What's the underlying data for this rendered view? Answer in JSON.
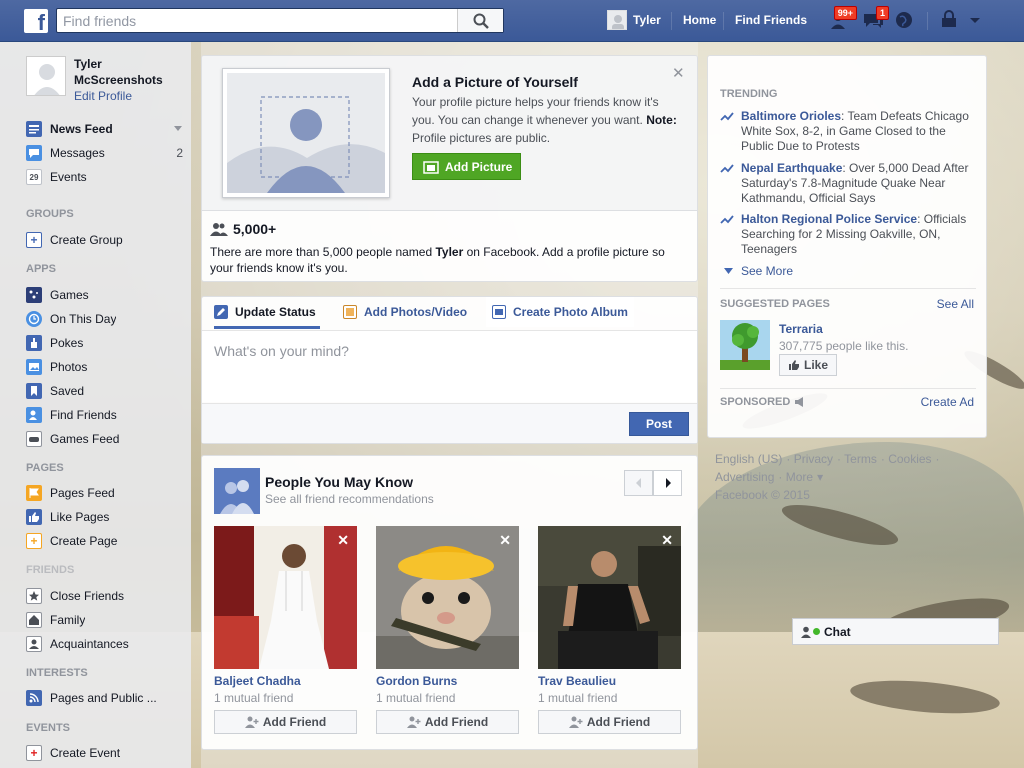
{
  "topbar": {
    "logo": "f",
    "search_placeholder": "Find friends",
    "user_name": "Tyler",
    "home": "Home",
    "find_friends": "Find Friends",
    "friend_requests_badge": "99+",
    "messages_badge": "1",
    "icons": [
      "search-icon",
      "friend-requests-icon",
      "messages-icon",
      "globe-icon",
      "privacy-icon",
      "chevron-down-icon"
    ]
  },
  "left": {
    "profile_name": "Tyler McScreenshots",
    "edit_profile": "Edit Profile",
    "items": {
      "news_feed": "News Feed",
      "messages": "Messages",
      "messages_count": "2",
      "events": "Events",
      "events_date": "29"
    },
    "groups_header": "GROUPS",
    "create_group": "Create Group",
    "apps_header": "APPS",
    "apps": [
      "Games",
      "On This Day",
      "Pokes",
      "Photos",
      "Saved",
      "Find Friends",
      "Games Feed"
    ],
    "pages_header": "PAGES",
    "pages": [
      "Pages Feed",
      "Like Pages",
      "Create Page"
    ],
    "friends_header": "FRIENDS",
    "friends": [
      "Close Friends",
      "Family",
      "Acquaintances"
    ],
    "interests_header": "INTERESTS",
    "interests": [
      "Pages and Public ..."
    ],
    "events_header": "EVENTS",
    "create_event": "Create Event"
  },
  "add_picture": {
    "title": "Add a Picture of Yourself",
    "text": "Your profile picture helps your friends know it's you. You can change it whenever you want.",
    "note_label": "Note:",
    "note_text": " Profile pictures are public.",
    "button": "Add Picture",
    "count": "5,000+",
    "people_text_1": "There are more than 5,000 people named ",
    "people_name": "Tyler",
    "people_text_2": " on Facebook. Add a profile picture so your friends know it's you."
  },
  "composer": {
    "tab_status": "Update Status",
    "tab_photos": "Add Photos/Video",
    "tab_album": "Create Photo Album",
    "placeholder": "What's on your mind?",
    "post": "Post"
  },
  "pymk": {
    "title": "People You May Know",
    "subtitle": "See all friend recommendations",
    "people": [
      {
        "name": "Baljeet Chadha",
        "mutual": "1 mutual friend",
        "button": "Add Friend"
      },
      {
        "name": "Gordon Burns",
        "mutual": "1 mutual friend",
        "button": "Add Friend"
      },
      {
        "name": "Trav Beaulieu",
        "mutual": "1 mutual friend",
        "button": "Add Friend"
      }
    ]
  },
  "right": {
    "trending_header": "TRENDING",
    "trends": [
      {
        "name": "Baltimore Orioles",
        "text": ": Team Defeats Chicago White Sox, 8-2, in Game Closed to the Public Due to Protests"
      },
      {
        "name": "Nepal Earthquake",
        "text": ": Over 5,000 Dead After Saturday's 7.8-Magnitude Quake Near Kathmandu, Official Says"
      },
      {
        "name": "Halton Regional Police Service",
        "text": ": Officials Searching for 2 Missing Oakville, ON, Teenagers"
      }
    ],
    "see_more": "See More",
    "suggested_header": "SUGGESTED PAGES",
    "see_all": "See All",
    "page_name": "Terraria",
    "page_likes": "307,775 people like this.",
    "like": "Like",
    "sponsored_header": "SPONSORED",
    "create_ad": "Create Ad"
  },
  "footer": {
    "links": [
      "English (US)",
      "Privacy",
      "Terms",
      "Cookies",
      "Advertising",
      "More"
    ],
    "copyright": "Facebook © 2015"
  },
  "chat": {
    "label": "Chat"
  }
}
